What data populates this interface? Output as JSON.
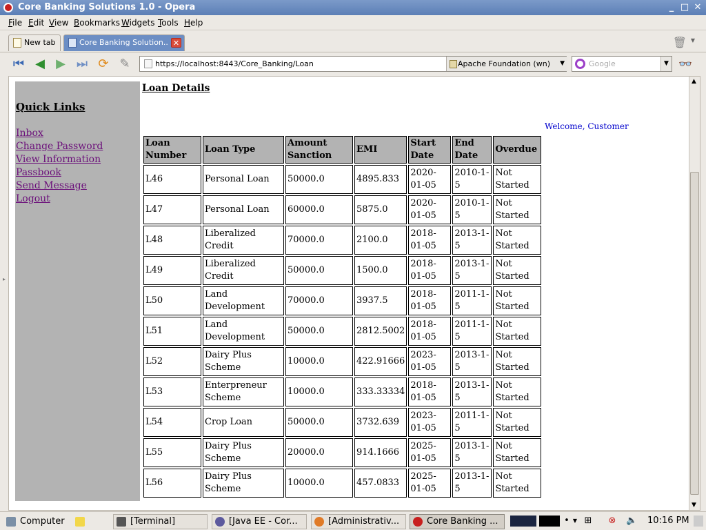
{
  "window": {
    "title": "Core Banking Solutions 1.0 - Opera"
  },
  "menu": [
    "File",
    "Edit",
    "View",
    "Bookmarks",
    "Widgets",
    "Tools",
    "Help"
  ],
  "tabs": [
    {
      "label": "New tab"
    },
    {
      "label": "Core Banking Solution..."
    }
  ],
  "address": {
    "url": "https://localhost:8443/Core_Banking/Loan",
    "site": "Apache Foundation (wn)"
  },
  "search": {
    "placeholder": "Google"
  },
  "sidebar": {
    "title": "Quick Links",
    "links": [
      "Inbox",
      "Change Password",
      "View Information",
      "Passbook",
      "Send Message",
      "Logout"
    ]
  },
  "page": {
    "title": "Loan Details",
    "welcome": "Welcome, Customer"
  },
  "table": {
    "headers": [
      "Loan Number",
      "Loan Type",
      "Amount Sanction",
      "EMI",
      "Start Date",
      "End Date",
      "Overdue"
    ],
    "rows": [
      [
        "L46",
        "Personal Loan",
        "50000.0",
        "4895.833",
        "2020-01-05",
        "2010-1-5",
        "Not Started"
      ],
      [
        "L47",
        "Personal Loan",
        "60000.0",
        "5875.0",
        "2020-01-05",
        "2010-1-5",
        "Not Started"
      ],
      [
        "L48",
        "Liberalized Credit",
        "70000.0",
        "2100.0",
        "2018-01-05",
        "2013-1-5",
        "Not Started"
      ],
      [
        "L49",
        "Liberalized Credit",
        "50000.0",
        "1500.0",
        "2018-01-05",
        "2013-1-5",
        "Not Started"
      ],
      [
        "L50",
        "Land Development",
        "70000.0",
        "3937.5",
        "2018-01-05",
        "2011-1-5",
        "Not Started"
      ],
      [
        "L51",
        "Land Development",
        "50000.0",
        "2812.5002",
        "2018-01-05",
        "2011-1-5",
        "Not Started"
      ],
      [
        "L52",
        "Dairy Plus Scheme",
        "10000.0",
        "422.91666",
        "2023-01-05",
        "2013-1-5",
        "Not Started"
      ],
      [
        "L53",
        "Enterpreneur Scheme",
        "10000.0",
        "333.33334",
        "2018-01-05",
        "2013-1-5",
        "Not Started"
      ],
      [
        "L54",
        "Crop Loan",
        "50000.0",
        "3732.639",
        "2023-01-05",
        "2011-1-5",
        "Not Started"
      ],
      [
        "L55",
        "Dairy Plus Scheme",
        "20000.0",
        "914.1666",
        "2025-01-05",
        "2013-1-5",
        "Not Started"
      ],
      [
        "L56",
        "Dairy Plus Scheme",
        "10000.0",
        "457.0833",
        "2025-01-05",
        "2013-1-5",
        "Not Started"
      ]
    ]
  },
  "taskbar": {
    "items": [
      "Computer",
      "[Terminal]",
      "[Java EE - Cor...",
      "[Administrativ...",
      "Core Banking ..."
    ],
    "clock": "10:16 PM"
  },
  "colors": {
    "link_visited": "#6b0f7a",
    "welcome": "#0000cc",
    "sidebar_bg": "#b3b3b3",
    "header_bg": "#b3b3b3"
  }
}
